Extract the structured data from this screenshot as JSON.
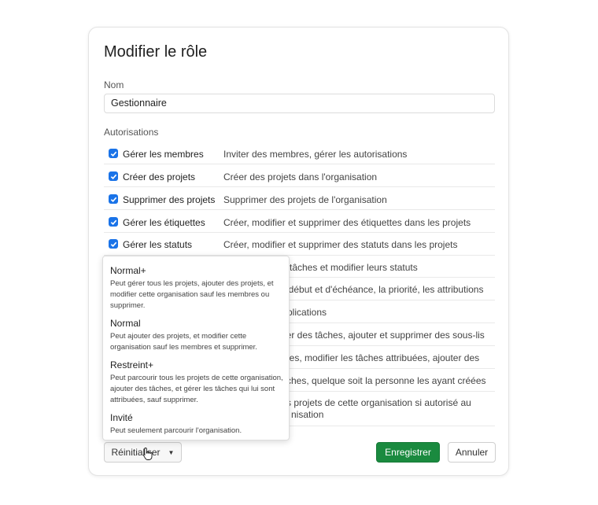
{
  "dialog": {
    "title": "Modifier le rôle",
    "name_label": "Nom",
    "name_value": "Gestionnaire",
    "permissions_label": "Autorisations"
  },
  "permissions": [
    {
      "name": "Gérer les membres",
      "desc": "Inviter des membres, gérer les autorisations",
      "checked": true
    },
    {
      "name": "Créer des projets",
      "desc": "Créer des projets dans l'organisation",
      "checked": true
    },
    {
      "name": "Supprimer des projets",
      "desc": "Supprimer des projets de l'organisation",
      "checked": true
    },
    {
      "name": "Gérer les étiquettes",
      "desc": "Créer, modifier et supprimer des étiquettes dans les projets",
      "checked": true
    },
    {
      "name": "Gérer les statuts",
      "desc": "Créer, modifier et supprimer des statuts dans les projets",
      "checked": true
    }
  ],
  "hidden_rows": [
    "tâches et modifier leurs statuts",
    "de début et d'échéance, la priorité, les attributions",
    "plications",
    "ier des tâches, ajouter et supprimer des sous-lis",
    "hes, modifier les tâches attribuées, ajouter des",
    "ches, quelque soit la personne les ayant créées",
    "s projets de cette organisation si autorisé au",
    "nisation"
  ],
  "dropdown": {
    "options": [
      {
        "title": "Normal+",
        "desc": "Peut gérer tous les projets, ajouter des projets, et modifier cette organisation sauf les membres ou supprimer."
      },
      {
        "title": "Normal",
        "desc": "Peut ajouter des projets, et modifier cette organisation sauf les membres et supprimer."
      },
      {
        "title": "Restreint+",
        "desc": "Peut parcourir tous les projets de cette organisation, ajouter des tâches, et gérer les tâches qui lui sont attribuées, sauf supprimer."
      },
      {
        "title": "Invité",
        "desc": "Peut seulement parcourir l'organisation."
      }
    ]
  },
  "footer": {
    "reset_label": "Réinitialiser",
    "save_label": "Enregistrer",
    "cancel_label": "Annuler"
  },
  "colors": {
    "checkbox": "#1a73e8",
    "save_button": "#1a8a3f"
  }
}
